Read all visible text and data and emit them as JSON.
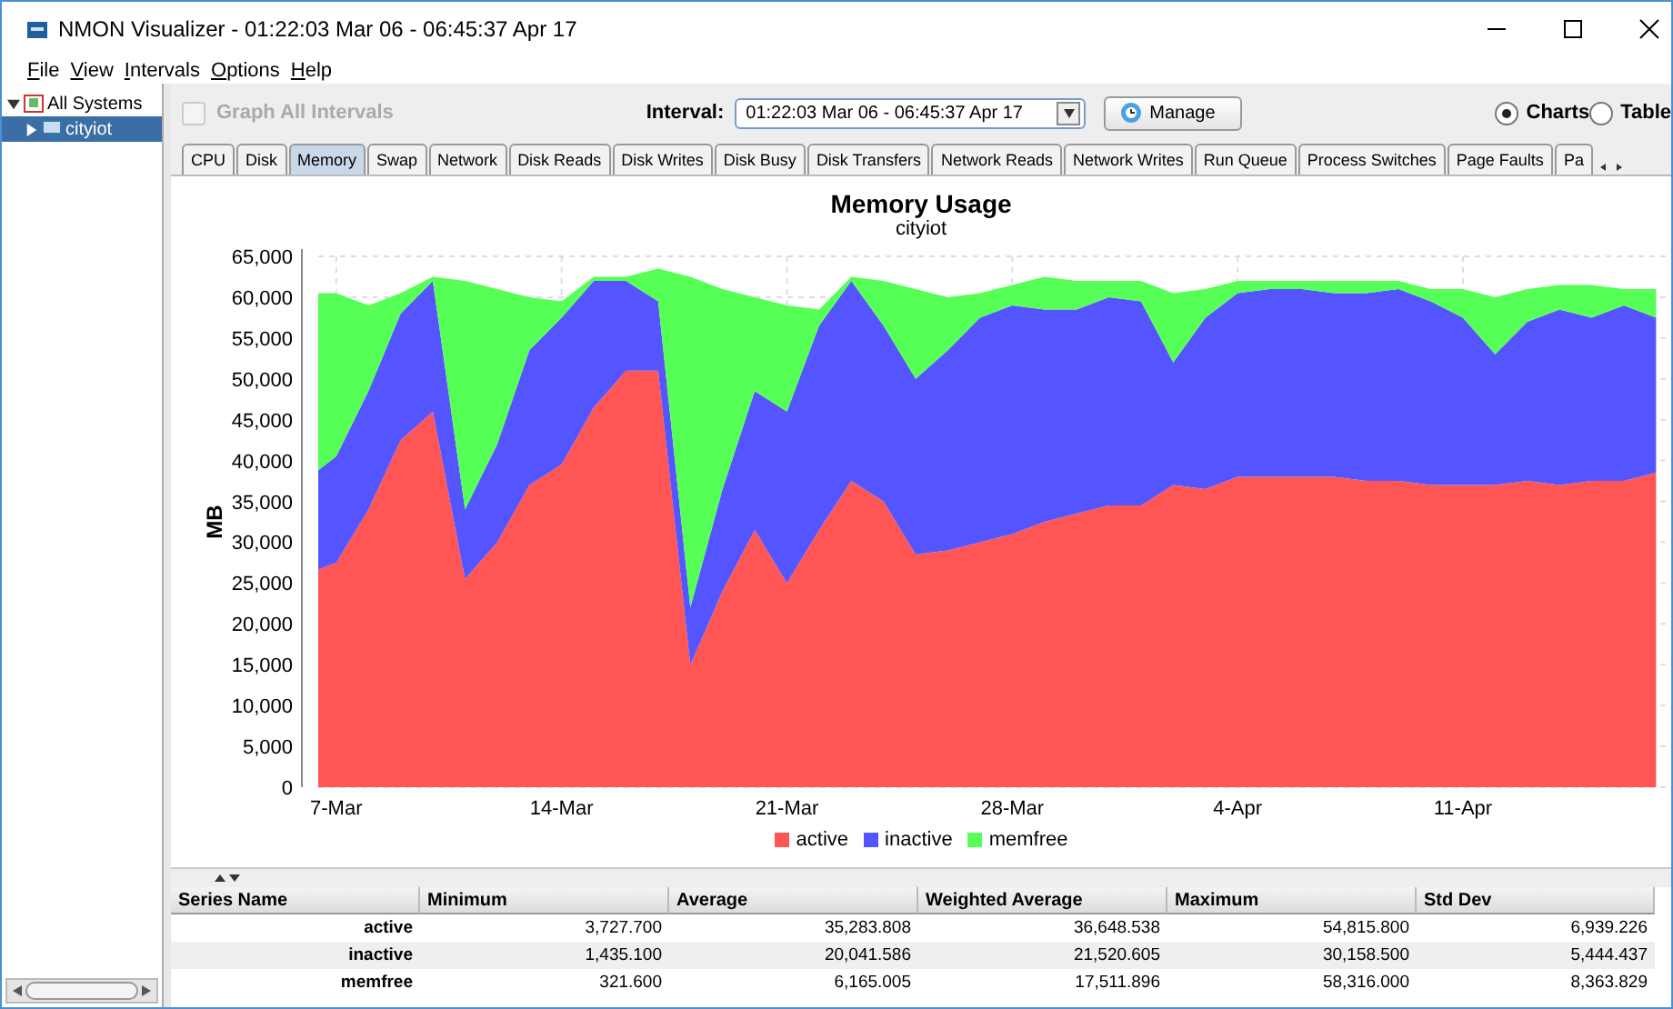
{
  "window": {
    "title": "NMON Visualizer - 01:22:03 Mar 06 - 06:45:37 Apr 17"
  },
  "menu": [
    "File",
    "View",
    "Intervals",
    "Options",
    "Help"
  ],
  "tree": [
    {
      "label": "All Systems",
      "expanded": true,
      "selected": false,
      "children": [
        {
          "label": "cityiot",
          "expanded": false,
          "selected": true
        }
      ]
    }
  ],
  "toolbar": {
    "graph_all": {
      "label": "Graph All Intervals",
      "checked": false,
      "disabled": true
    },
    "interval_label": "Interval:",
    "interval_value": "01:22:03 Mar 06 - 06:45:37 Apr 17",
    "manage": "Manage",
    "views": [
      {
        "label": "Charts",
        "selected": true
      },
      {
        "label": "Table",
        "selected": false
      }
    ]
  },
  "tabs": [
    {
      "label": "CPU",
      "selected": false
    },
    {
      "label": "Disk",
      "selected": false
    },
    {
      "label": "Memory",
      "selected": true
    },
    {
      "label": "Swap",
      "selected": false
    },
    {
      "label": "Network",
      "selected": false
    },
    {
      "label": "Disk Reads",
      "selected": false
    },
    {
      "label": "Disk Writes",
      "selected": false
    },
    {
      "label": "Disk Busy",
      "selected": false
    },
    {
      "label": "Disk Transfers",
      "selected": false
    },
    {
      "label": "Network Reads",
      "selected": false
    },
    {
      "label": "Network Writes",
      "selected": false
    },
    {
      "label": "Run Queue",
      "selected": false
    },
    {
      "label": "Process Switches",
      "selected": false
    },
    {
      "label": "Page Faults",
      "selected": false
    },
    {
      "label": "Pa",
      "selected": false
    }
  ],
  "chart": {
    "title": "Memory Usage",
    "subtitle": "cityiot",
    "chart_data": {
      "type": "area",
      "stacked": true,
      "ylabel": "MB",
      "grid": true,
      "ylim": [
        0,
        65000
      ],
      "yticks": [
        {
          "value": 0,
          "label": "0"
        },
        {
          "value": 5000,
          "label": "5,000"
        },
        {
          "value": 10000,
          "label": "10,000"
        },
        {
          "value": 15000,
          "label": "15,000"
        },
        {
          "value": 20000,
          "label": "20,000"
        },
        {
          "value": 25000,
          "label": "25,000"
        },
        {
          "value": 30000,
          "label": "30,000"
        },
        {
          "value": 35000,
          "label": "35,000"
        },
        {
          "value": 40000,
          "label": "40,000"
        },
        {
          "value": 45000,
          "label": "45,000"
        },
        {
          "value": 50000,
          "label": "50,000"
        },
        {
          "value": 55000,
          "label": "55,000"
        },
        {
          "value": 60000,
          "label": "60,000"
        },
        {
          "value": 65000,
          "label": "65,000"
        }
      ],
      "categories": [
        null,
        "7-Mar",
        null,
        null,
        null,
        null,
        null,
        null,
        "14-Mar",
        null,
        null,
        null,
        null,
        null,
        null,
        "21-Mar",
        null,
        null,
        null,
        null,
        null,
        null,
        "28-Mar",
        null,
        null,
        null,
        null,
        null,
        null,
        "4-Apr",
        null,
        null,
        null,
        null,
        null,
        null,
        "11-Apr",
        null,
        null,
        null,
        null,
        null,
        null
      ],
      "series": [
        {
          "name": "active",
          "color": "#ff5555",
          "values": [
            26000,
            27500,
            34000,
            42500,
            46000,
            25500,
            30000,
            37000,
            39500,
            46500,
            51000,
            51000,
            15000,
            24000,
            31500,
            25000,
            31500,
            37500,
            35000,
            28500,
            29000,
            30000,
            31000,
            32500,
            33500,
            34500,
            34500,
            37000,
            36500,
            38000,
            38000,
            38000,
            38000,
            37500,
            37500,
            37000,
            37000,
            37000,
            37500,
            37000,
            37500,
            37500,
            38500
          ]
        },
        {
          "name": "inactive",
          "color": "#5555ff",
          "values": [
            11500,
            13000,
            14500,
            15500,
            16000,
            8500,
            12000,
            16500,
            18000,
            15500,
            11000,
            8500,
            7000,
            12500,
            17000,
            21000,
            25000,
            24500,
            21500,
            21500,
            24500,
            27500,
            28000,
            26000,
            25000,
            25500,
            25000,
            15000,
            21000,
            22500,
            23000,
            23000,
            22500,
            23000,
            23500,
            22500,
            20500,
            16000,
            19500,
            21500,
            20000,
            21500,
            19000
          ]
        },
        {
          "name": "memfree",
          "color": "#55ff55",
          "values": [
            23000,
            20000,
            10500,
            2500,
            500,
            28000,
            19000,
            6500,
            2000,
            500,
            500,
            4000,
            40500,
            24500,
            11500,
            13000,
            2000,
            500,
            5500,
            11000,
            6500,
            3000,
            2500,
            4000,
            3500,
            2000,
            2500,
            8500,
            3500,
            1500,
            1000,
            1000,
            1500,
            1500,
            1000,
            1500,
            3500,
            7000,
            4000,
            3000,
            4000,
            2000,
            3500
          ]
        }
      ]
    }
  },
  "stats": {
    "columns": [
      "Series Name",
      "Minimum",
      "Average",
      "Weighted Average",
      "Maximum",
      "Std Dev"
    ],
    "rows": [
      [
        "active",
        "3,727.700",
        "35,283.808",
        "36,648.538",
        "54,815.800",
        "6,939.226"
      ],
      [
        "inactive",
        "1,435.100",
        "20,041.586",
        "21,520.605",
        "30,158.500",
        "5,444.437"
      ],
      [
        "memfree",
        "321.600",
        "6,165.005",
        "17,511.896",
        "58,316.000",
        "8,363.829"
      ]
    ]
  }
}
